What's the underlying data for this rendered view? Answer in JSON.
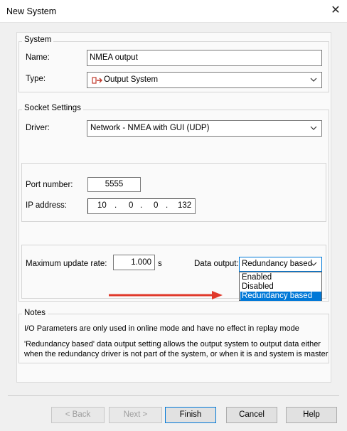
{
  "window": {
    "title": "New System",
    "close_glyph": "✕"
  },
  "system": {
    "legend": "System",
    "name_label": "Name:",
    "name_value": "NMEA output",
    "type_label": "Type:",
    "type_value": "Output System",
    "type_icon": "output-system-icon"
  },
  "socket": {
    "legend": "Socket Settings",
    "driver_label": "Driver:",
    "driver_value": "Network - NMEA with GUI (UDP)",
    "port_label": "Port number:",
    "port_value": "5555",
    "ip_label": "IP address:",
    "ip_octets": [
      "10",
      "0",
      "0",
      "132"
    ],
    "ip_dot": ".",
    "rate_label": "Maximum update rate:",
    "rate_value": "1.000",
    "rate_unit": "s",
    "output_label": "Data output:",
    "output_selected": "Redundancy based",
    "output_options": [
      "Enabled",
      "Disabled",
      "Redundancy based"
    ],
    "arrow_color": "#e0392b"
  },
  "notes": {
    "legend": "Notes",
    "line1": "I/O Parameters are only used in online mode and have no effect in replay mode",
    "line2": "'Redundancy based' data output setting allows the output system to output data either",
    "line3": "when the redundancy driver is not part of the system, or when it is and system is master"
  },
  "buttons": {
    "back": "< Back",
    "next": "Next >",
    "finish": "Finish",
    "cancel": "Cancel",
    "help": "Help"
  },
  "colors": {
    "accent": "#0078d7",
    "selection": "#0078d7"
  }
}
